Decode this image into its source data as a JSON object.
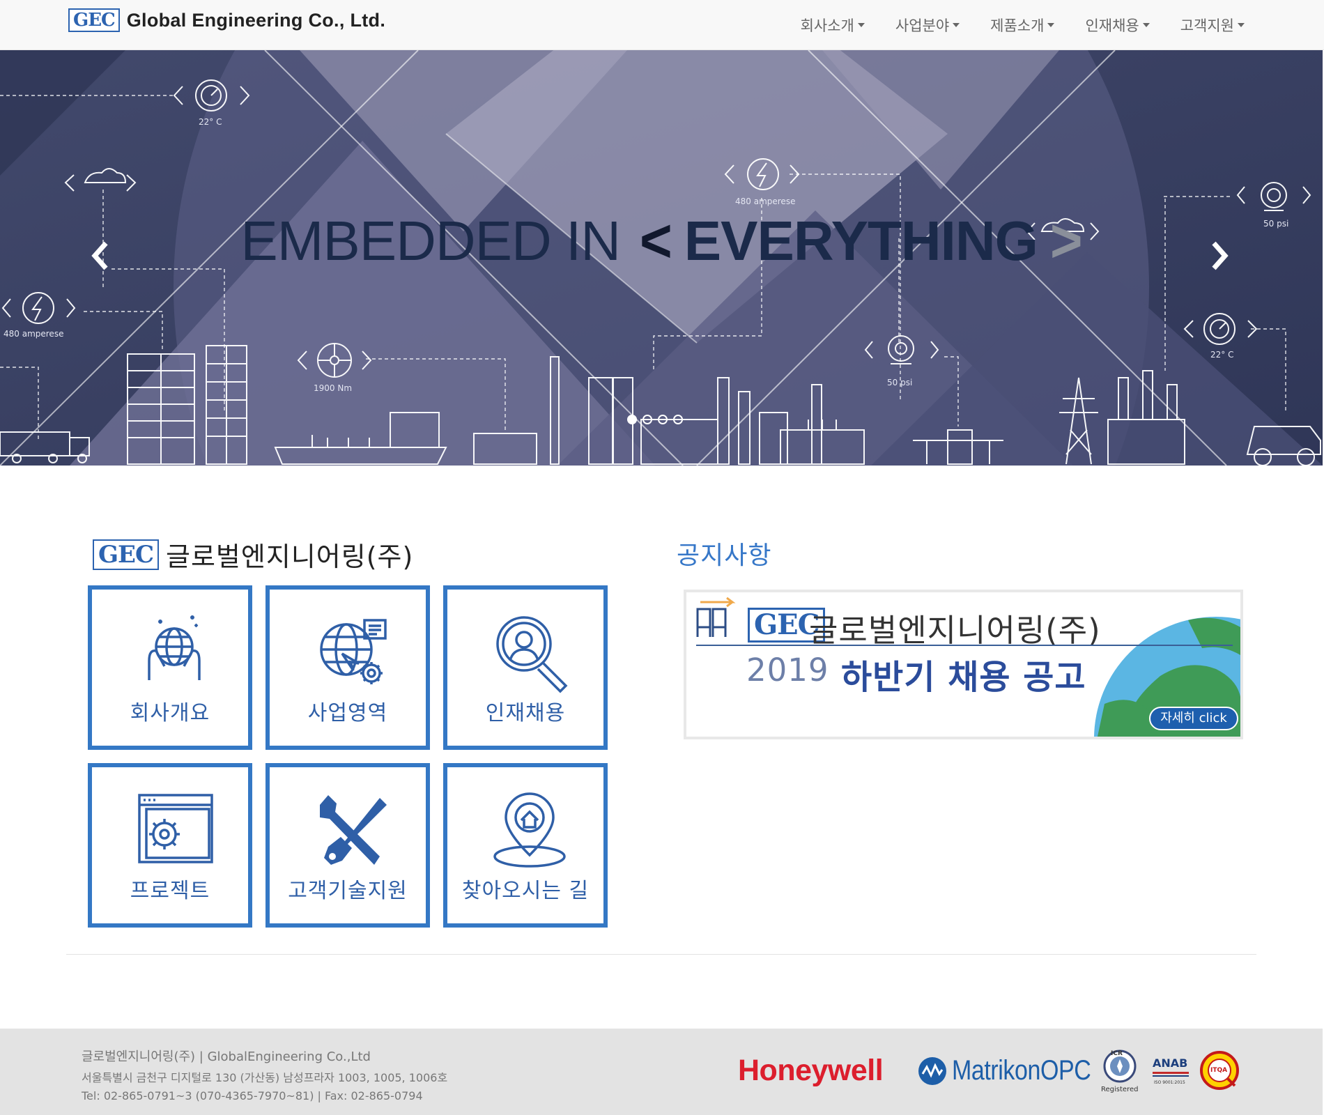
{
  "navbar": {
    "logo_text": "GEC",
    "brand_name": "Global Engineering Co., Ltd.",
    "menu": [
      {
        "label": "회사소개"
      },
      {
        "label": "사업분야"
      },
      {
        "label": "제품소개"
      },
      {
        "label": "인재채용"
      },
      {
        "label": "고객지원"
      }
    ]
  },
  "hero": {
    "title_part1": "EMBEDDED IN",
    "title_chevron_left": "<",
    "title_part2": "EVERYTHING",
    "title_chevron_right": ">",
    "labels": {
      "temp_top": "22° C",
      "amp_mid": "480 amperese",
      "amp_left": "480 amperese",
      "torque": "1900 Nm",
      "pressure_mid": "50 psi",
      "pressure_right": "50 psi",
      "temp_right": "22° C"
    },
    "prev_icon": "chevron-left-icon",
    "next_icon": "chevron-right-icon",
    "slide_count": 4,
    "active_slide": 1,
    "colors": {
      "bg_dark": "#3d4466",
      "bg_mid": "#6e7195",
      "bg_light": "#a4a3bd"
    }
  },
  "company": {
    "logo_text": "GEC",
    "name": "글로벌엔지니어링(주)",
    "tiles": [
      {
        "label": "회사개요",
        "icon": "globe-hands-icon"
      },
      {
        "label": "사업영역",
        "icon": "globe-gear-icon"
      },
      {
        "label": "인재채용",
        "icon": "person-search-icon"
      },
      {
        "label": "프로젝트",
        "icon": "project-gear-icon"
      },
      {
        "label": "고객기술지원",
        "icon": "tools-icon"
      },
      {
        "label": "찾아오시는 길",
        "icon": "location-pin-icon"
      }
    ],
    "accent_color": "#3478c5"
  },
  "notice": {
    "title": "공지사항",
    "banner": {
      "logo_text": "GEC",
      "company": "글로벌엔지니어링(주)",
      "year": "2019",
      "headline": "하반기 채용 공고",
      "button": "자세히 click"
    }
  },
  "footer": {
    "line1": "글로벌엔지니어링(주) | GlobalEngineering Co.,Ltd",
    "line2": "서울특별시 금천구 디지털로 130 (가산동) 남성프라자 1003, 1005, 1006호",
    "line3": "Tel: 02-865-0791~3 (070-4365-7970~81) | Fax: 02-865-0794",
    "partner1": "Honeywell",
    "partner2": "MatrikonOPC",
    "cert1_label": "Registered",
    "cert1_top": "ICR",
    "cert2_top": "ANAB",
    "cert2_bottom": "ISO 9001:2015",
    "cert3_top": "ITQA"
  }
}
